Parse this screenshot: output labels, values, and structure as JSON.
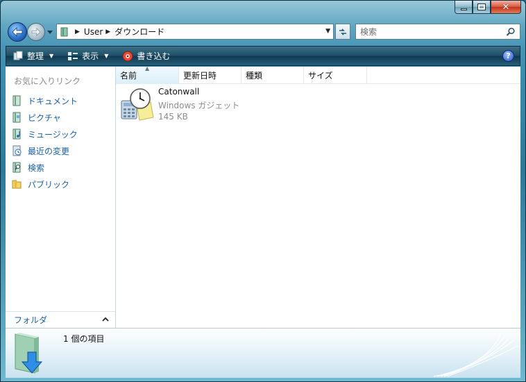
{
  "window": {
    "caption": {
      "minimize": "minimize",
      "maximize": "maximize",
      "close": "close"
    }
  },
  "address": {
    "crumbs": [
      "User",
      "ダウンロード"
    ]
  },
  "search": {
    "placeholder": "検索"
  },
  "commands": {
    "organize": "整理",
    "views": "表示",
    "burn": "書き込む",
    "help": "?"
  },
  "nav": {
    "favorites_header": "お気に入りリンク",
    "items": [
      {
        "label": "ドキュメント",
        "icon": "documents-icon"
      },
      {
        "label": "ピクチャ",
        "icon": "pictures-icon"
      },
      {
        "label": "ミュージック",
        "icon": "music-icon"
      },
      {
        "label": "最近の変更",
        "icon": "recent-changes-icon"
      },
      {
        "label": "検索",
        "icon": "searches-icon"
      },
      {
        "label": "パブリック",
        "icon": "public-folder-icon"
      }
    ],
    "folders_label": "フォルダ"
  },
  "columns": [
    "名前",
    "更新日時",
    "種類",
    "サイズ"
  ],
  "files": [
    {
      "name": "Catonwall",
      "type": "Windows ガジェット",
      "size": "145 KB",
      "icon": "gadget-file-icon"
    }
  ],
  "details": {
    "item_count": "1 個の項目"
  },
  "colors": {
    "link": "#1b5fa4",
    "command_bar": "#1f4f66",
    "frame": "#2f7897"
  }
}
